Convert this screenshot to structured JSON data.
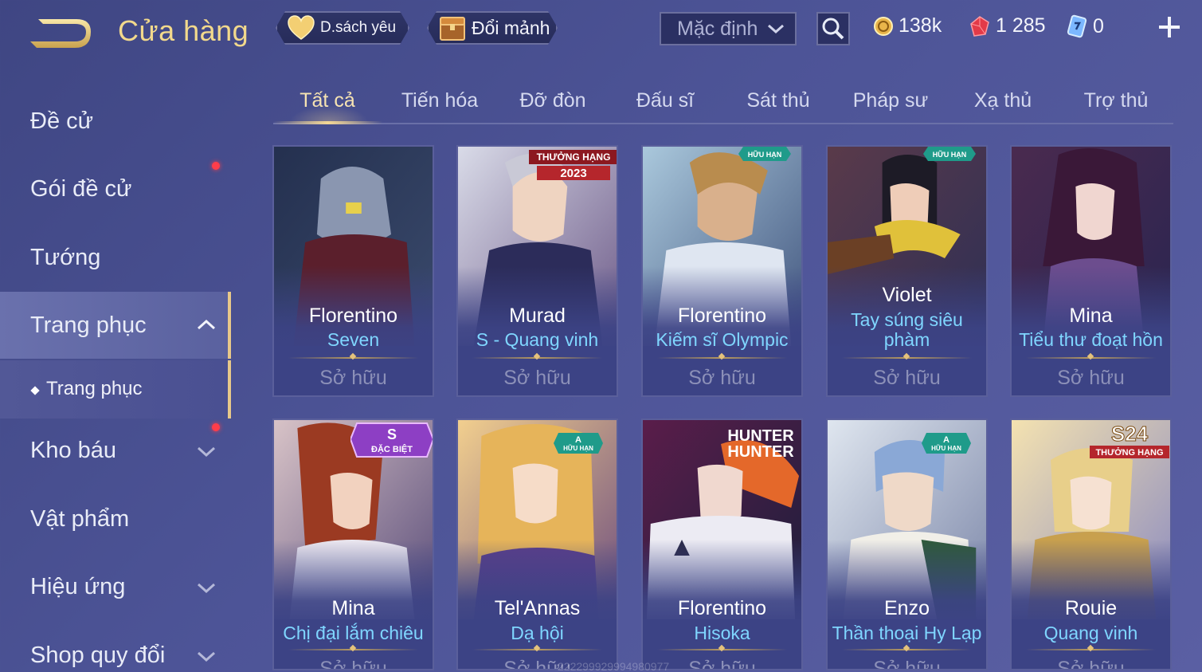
{
  "header": {
    "title": "Cửa hàng",
    "favorites_label": "D.sách yêu",
    "exchange_label": "Đổi mảnh",
    "sort_value": "Mặc định",
    "gold": "138k",
    "gems": "1 285",
    "vouchers": "0"
  },
  "sidebar": {
    "items": [
      {
        "label": "Đề cử"
      },
      {
        "label": "Gói đề cử"
      },
      {
        "label": "Tướng"
      },
      {
        "label": "Trang phục"
      },
      {
        "label": "Kho báu"
      },
      {
        "label": "Vật phẩm"
      },
      {
        "label": "Hiệu ứng"
      },
      {
        "label": "Shop quy đổi"
      }
    ],
    "sub_item": "Trang phục"
  },
  "tabs": [
    "Tất cả",
    "Tiến hóa",
    "Đỡ đòn",
    "Đấu sĩ",
    "Sát thủ",
    "Pháp sư",
    "Xạ thủ",
    "Trợ thủ"
  ],
  "cards": [
    {
      "hero": "Florentino",
      "skin": "Seven",
      "status": "Sở hữu",
      "badge": ""
    },
    {
      "hero": "Murad",
      "skin": "S - Quang vinh",
      "status": "Sở hữu",
      "badge": "THƯỞNG HẠNG 2023"
    },
    {
      "hero": "Florentino",
      "skin": "Kiếm sĩ Olympic",
      "status": "Sở hữu",
      "badge": "HỮU HẠN"
    },
    {
      "hero": "Violet",
      "skin": "Tay súng siêu phàm",
      "status": "Sở hữu",
      "badge": "HỮU HẠN"
    },
    {
      "hero": "Mina",
      "skin": "Tiểu thư đoạt hồn",
      "status": "Sở hữu",
      "badge": ""
    },
    {
      "hero": "Mina",
      "skin": "Chị đại lắm chiêu",
      "status": "Sở hữu",
      "badge": "S ĐẶC BIỆT"
    },
    {
      "hero": "Tel'Annas",
      "skin": "Dạ hội",
      "status": "Sở hữu",
      "badge": "A HỮU HẠN"
    },
    {
      "hero": "Florentino",
      "skin": "Hisoka",
      "status": "Sở hữu",
      "badge": "HUNTER"
    },
    {
      "hero": "Enzo",
      "skin": "Thần thoại Hy Lạp",
      "status": "Sở hữu",
      "badge": "A HỮU HẠN"
    },
    {
      "hero": "Rouie",
      "skin": "Quang vinh",
      "status": "Sở hữu",
      "badge": "S24 THƯỞNG HẠNG"
    }
  ],
  "badges": {
    "s_label": "S",
    "special": "ĐẶC BIỆT",
    "limited": "HỮU HẠN",
    "limited_a": "A",
    "rank_reward": "THƯỞNG HẠNG",
    "year": "2023",
    "season": "S24",
    "hunter1": "HUNTER",
    "hunter2": "HUNTER"
  },
  "watermark": "222299929994980977",
  "colors": {
    "background": "#4a5196",
    "accent_gold": "#f2d98c",
    "skin_name": "#7fd6ff",
    "owned_text": "#8c90b8",
    "notification": "#ff3d4a"
  }
}
